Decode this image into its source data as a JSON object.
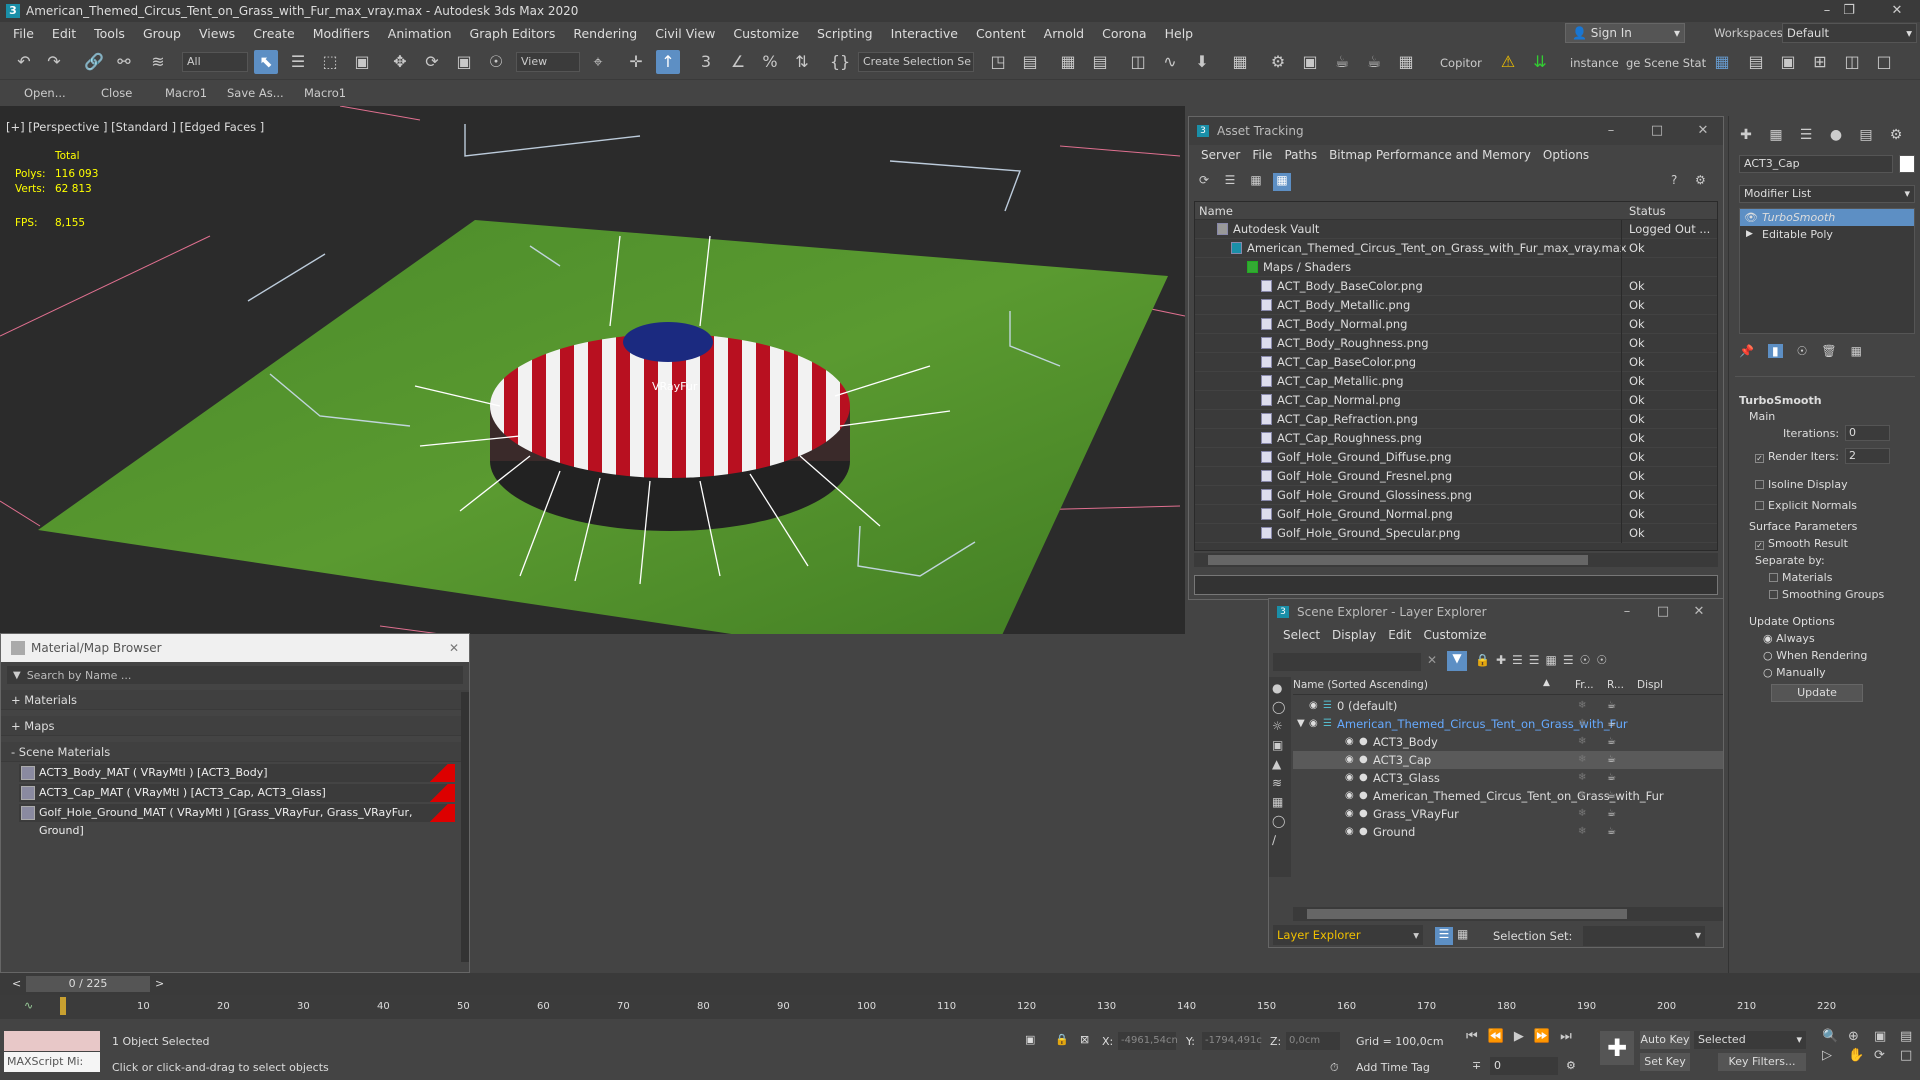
{
  "window": {
    "title": "American_Themed_Circus_Tent_on_Grass_with_Fur_max_vray.max - Autodesk 3ds Max 2020",
    "logo": "3"
  },
  "menu": [
    "File",
    "Edit",
    "Tools",
    "Group",
    "Views",
    "Create",
    "Modifiers",
    "Animation",
    "Graph Editors",
    "Rendering",
    "Civil View",
    "Customize",
    "Scripting",
    "Interactive",
    "Content",
    "Arnold",
    "Corona",
    "Help"
  ],
  "signin": "Sign In",
  "workspaces_label": "Workspaces:",
  "workspace": "Default",
  "toolbar": {
    "filter": "All",
    "refcoord": "View",
    "selset": "Create Selection Se",
    "copitor": "Copitor",
    "instance": "instance",
    "scenestat": "ge Scene Stat"
  },
  "macros": [
    "Open...",
    "Close",
    "Macro1",
    "Save As...",
    "Macro1"
  ],
  "viewport": {
    "label": "[+] [Perspective ] [Standard ] [Edged Faces ]",
    "total": "Total",
    "polys_label": "Polys:",
    "polys": "116 093",
    "verts_label": "Verts:",
    "verts": "62 813",
    "fps_label": "FPS:",
    "fps": "8,155",
    "fur_label": "VRayFur"
  },
  "asset": {
    "title": "Asset Tracking",
    "menu": [
      "Server",
      "File",
      "Paths",
      "Bitmap Performance and Memory",
      "Options"
    ],
    "col_name": "Name",
    "col_status": "Status",
    "rows": [
      {
        "name": "Autodesk Vault",
        "status": "Logged Out ...",
        "indent": 22,
        "type": "vault"
      },
      {
        "name": "American_Themed_Circus_Tent_on_Grass_with_Fur_max_vray.max",
        "status": "Ok",
        "indent": 36,
        "type": "max"
      },
      {
        "name": "Maps / Shaders",
        "status": "",
        "indent": 52,
        "type": "folder"
      },
      {
        "name": "ACT_Body_BaseColor.png",
        "status": "Ok",
        "indent": 66,
        "type": "file"
      },
      {
        "name": "ACT_Body_Metallic.png",
        "status": "Ok",
        "indent": 66,
        "type": "file"
      },
      {
        "name": "ACT_Body_Normal.png",
        "status": "Ok",
        "indent": 66,
        "type": "file"
      },
      {
        "name": "ACT_Body_Roughness.png",
        "status": "Ok",
        "indent": 66,
        "type": "file"
      },
      {
        "name": "ACT_Cap_BaseColor.png",
        "status": "Ok",
        "indent": 66,
        "type": "file"
      },
      {
        "name": "ACT_Cap_Metallic.png",
        "status": "Ok",
        "indent": 66,
        "type": "file"
      },
      {
        "name": "ACT_Cap_Normal.png",
        "status": "Ok",
        "indent": 66,
        "type": "file"
      },
      {
        "name": "ACT_Cap_Refraction.png",
        "status": "Ok",
        "indent": 66,
        "type": "file"
      },
      {
        "name": "ACT_Cap_Roughness.png",
        "status": "Ok",
        "indent": 66,
        "type": "file"
      },
      {
        "name": "Golf_Hole_Ground_Diffuse.png",
        "status": "Ok",
        "indent": 66,
        "type": "file"
      },
      {
        "name": "Golf_Hole_Ground_Fresnel.png",
        "status": "Ok",
        "indent": 66,
        "type": "file"
      },
      {
        "name": "Golf_Hole_Ground_Glossiness.png",
        "status": "Ok",
        "indent": 66,
        "type": "file"
      },
      {
        "name": "Golf_Hole_Ground_Normal.png",
        "status": "Ok",
        "indent": 66,
        "type": "file"
      },
      {
        "name": "Golf_Hole_Ground_Specular.png",
        "status": "Ok",
        "indent": 66,
        "type": "file"
      }
    ]
  },
  "matbrowser": {
    "title": "Material/Map Browser",
    "search_placeholder": "Search by Name ...",
    "sec_materials": "+ Materials",
    "sec_maps": "+ Maps",
    "sec_scene": "- Scene Materials",
    "items": [
      "ACT3_Body_MAT ( VRayMtl ) [ACT3_Body]",
      "ACT3_Cap_MAT ( VRayMtl ) [ACT3_Cap, ACT3_Glass]",
      "Golf_Hole_Ground_MAT ( VRayMtl ) [Grass_VRayFur, Grass_VRayFur, Ground]"
    ]
  },
  "scene": {
    "title": "Scene Explorer - Layer Explorer",
    "menu": [
      "Select",
      "Display",
      "Edit",
      "Customize"
    ],
    "col_name": "Name (Sorted Ascending)",
    "col_fr": "Fr...",
    "col_r": "R...",
    "col_disp": "Displ",
    "rows": [
      {
        "name": "0 (default)",
        "indent": 0,
        "selected": false
      },
      {
        "name": "American_Themed_Circus_Tent_on_Grass_with_Fur",
        "indent": 0,
        "selected": false,
        "blue": true
      },
      {
        "name": "ACT3_Body",
        "indent": 1,
        "selected": false
      },
      {
        "name": "ACT3_Cap",
        "indent": 1,
        "selected": true
      },
      {
        "name": "ACT3_Glass",
        "indent": 1,
        "selected": false
      },
      {
        "name": "American_Themed_Circus_Tent_on_Grass_with_Fur",
        "indent": 1,
        "selected": false
      },
      {
        "name": "Grass_VRayFur",
        "indent": 1,
        "selected": false
      },
      {
        "name": "Ground",
        "indent": 1,
        "selected": false
      }
    ],
    "explorer": "Layer Explorer",
    "selset_label": "Selection Set:"
  },
  "cmdpanel": {
    "objname": "ACT3_Cap",
    "modlist": "Modifier List",
    "stack": [
      "TurboSmooth",
      "Editable Poly"
    ],
    "ts_title": "TurboSmooth",
    "main": "Main",
    "iterations_label": "Iterations:",
    "iterations": "0",
    "render_iters_label": "Render Iters:",
    "render_iters": "2",
    "isoline": "Isoline Display",
    "explicit": "Explicit Normals",
    "surface": "Surface Parameters",
    "smooth": "Smooth Result",
    "separate": "Separate by:",
    "materials": "Materials",
    "smoothing": "Smoothing Groups",
    "update_opts": "Update Options",
    "always": "Always",
    "when_rendering": "When Rendering",
    "manually": "Manually",
    "update": "Update"
  },
  "time": {
    "slider": "0 / 225",
    "ticks": [
      "10",
      "20",
      "30",
      "40",
      "50",
      "60",
      "70",
      "80",
      "90",
      "100",
      "110",
      "120",
      "130",
      "140",
      "150",
      "160",
      "170",
      "180",
      "190",
      "200",
      "210",
      "220"
    ]
  },
  "status": {
    "maxscript": "MAXScript Mi:",
    "selected": "1 Object Selected",
    "prompt": "Click or click-and-drag to select objects",
    "x_label": "X:",
    "x": "-4961,54cn",
    "y_label": "Y:",
    "y": "-1794,491c",
    "z_label": "Z:",
    "z": "0,0cm",
    "grid": "Grid = 100,0cm",
    "add_time_tag": "Add Time Tag",
    "auto_key": "Auto Key",
    "set_key": "Set Key",
    "key_mode": "Selected",
    "key_filters": "Key Filters...",
    "frame": "0"
  }
}
